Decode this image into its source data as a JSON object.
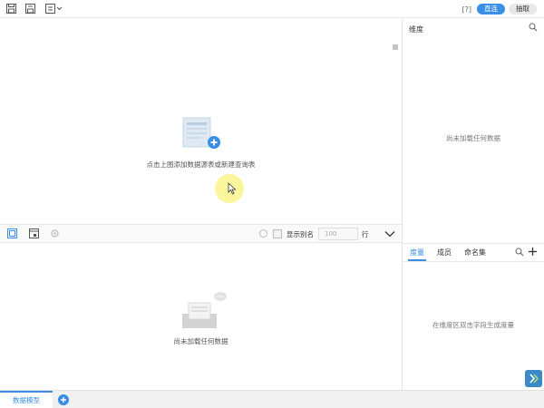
{
  "toolbar": {
    "icons": [
      "save-icon",
      "save-as-icon",
      "export-dropdown-icon"
    ],
    "help_label": "[?]",
    "modes": [
      {
        "label": "直连",
        "active": true
      },
      {
        "label": "抽取",
        "active": false
      }
    ]
  },
  "canvas": {
    "hint": "点击上图添加数据源表或新建查询表"
  },
  "dimension_panel": {
    "title": "维度",
    "empty_text": "尚未加载任何数据"
  },
  "table_toolbar": {
    "icons": [
      "table-view-icon",
      "preview-window-icon",
      "settings-icon",
      "refresh-icon"
    ],
    "alias_label": "显示别名",
    "row_count": "100",
    "row_label": "行"
  },
  "result_area": {
    "empty_text": "尚未加载任何数据"
  },
  "measure_panel": {
    "tabs": [
      {
        "label": "度量",
        "active": true
      },
      {
        "label": "成员",
        "active": false
      },
      {
        "label": "命名集",
        "active": false
      }
    ],
    "empty_text": "在维度区双击字段生成度量"
  },
  "bottom_bar": {
    "sheet_tab": "数据模型"
  },
  "colors": {
    "accent": "#3a8ee6",
    "divider": "#e4e4e4",
    "highlight": "#faf58c"
  }
}
